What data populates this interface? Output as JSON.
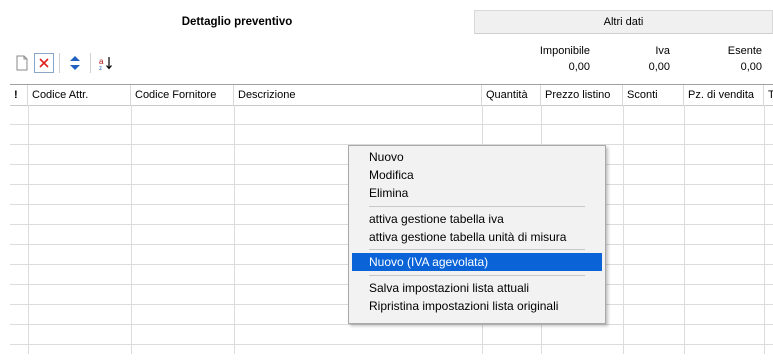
{
  "tabs": {
    "active": "Dettaglio preventivo",
    "other": "Altri dati"
  },
  "toolbar": {
    "icons": [
      "new-document-icon",
      "delete-icon",
      "move-up-down-icon",
      "sort-icon"
    ],
    "sort_glyph": "a↓"
  },
  "totals": {
    "imponibile_label": "Imponibile",
    "imponibile_value": "0,00",
    "iva_label": "Iva",
    "iva_value": "0,00",
    "esente_label": "Esente",
    "esente_value": "0,00"
  },
  "grid": {
    "columns": [
      "!",
      "Codice Attr.",
      "Codice Fornitore",
      "Descrizione",
      "Quantità",
      "Prezzo listino",
      "Sconti",
      "Pz. di vendita",
      "T"
    ]
  },
  "context_menu": {
    "items": [
      "Nuovo",
      "Modifica",
      "Elimina",
      "attiva gestione tabella iva",
      "attiva gestione tabella unità di misura",
      "Nuovo (IVA agevolata)",
      "Salva impostazioni lista attuali",
      "Ripristina impostazioni lista originali"
    ],
    "selected": "Nuovo (IVA agevolata)"
  },
  "colors": {
    "selection": "#0a64d8",
    "delete_icon": "#e02020",
    "arrow_icon": "#2060c0"
  }
}
